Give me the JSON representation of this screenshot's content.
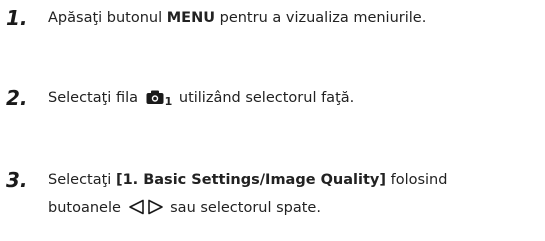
{
  "steps": [
    {
      "number": "1.",
      "pre": "Apăsaţi butonul ",
      "bold": "MENU",
      "post": " pentru a vizualiza meniurile."
    },
    {
      "number": "2.",
      "pre": "Selectaţi fila ",
      "icon": "camera-icon",
      "subscript": "1",
      "post": " utilizând selectorul faţă."
    },
    {
      "number": "3.",
      "pre": "Selectaţi ",
      "bold": "[1. Basic Settings/Image Quality]",
      "post": " folosind",
      "line2_pre": "butoanele ",
      "arrows_icon": "left-right-arrows-icon",
      "line2_post": " sau selectorul spate."
    }
  ]
}
